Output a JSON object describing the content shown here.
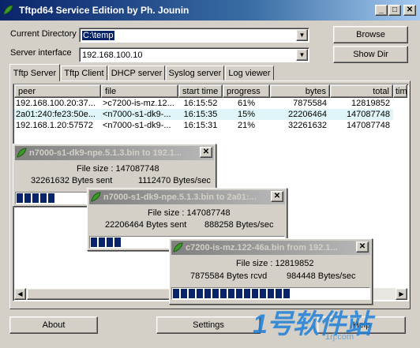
{
  "window": {
    "title": "Tftpd64 Service Edition by Ph. Jounin",
    "min": "_",
    "max": "□",
    "close": "✕"
  },
  "form": {
    "dir_label": "Current Directory",
    "dir_value": "C:\\temp",
    "iface_label": "Server interface",
    "iface_value": "192.168.100.10",
    "browse": "Browse",
    "showdir": "Show Dir"
  },
  "tabs": [
    "Tftp Server",
    "Tftp Client",
    "DHCP server",
    "Syslog server",
    "Log viewer"
  ],
  "table": {
    "headers": [
      "peer",
      "file",
      "start time",
      "progress",
      "bytes",
      "total",
      "tim"
    ],
    "rows": [
      [
        "192.168.100.20:37...",
        ">c7200-is-mz.12...",
        "16:15:52",
        "61%",
        "7875584",
        "12819852"
      ],
      [
        "2a01:240:fe23:50e...",
        "<n7000-s1-dk9-...",
        "16:15:35",
        "15%",
        "22206464",
        "147087748"
      ],
      [
        "192.168.1.20:57572",
        "<n7000-s1-dk9-...",
        "16:15:31",
        "21%",
        "32261632",
        "147087748"
      ]
    ]
  },
  "dialogs": [
    {
      "title": "n7000-s1-dk9-npe.5.1.3.bin to 192.1...",
      "size": "File size : 147087748",
      "count": "32261632 Bytes sent",
      "rate": "1112470 Bytes/sec",
      "progress": 0.21
    },
    {
      "title": "n7000-s1-dk9-npe.5.1.3.bin to 2a01:...",
      "size": "File size : 147087748",
      "count": "22206464 Bytes sent",
      "rate": "888258 Bytes/sec",
      "progress": 0.15
    },
    {
      "title": "c7200-is-mz.122-46a.bin from 192.1...",
      "size": "File size : 12819852",
      "count": "7875584 Bytes rcvd",
      "rate": "984448 Bytes/sec",
      "progress": 0.61
    }
  ],
  "bottom": {
    "about": "About",
    "settings": "Settings",
    "help": "Help"
  },
  "watermark": {
    "brand": "1号软件站",
    "url": "1rj.com"
  },
  "colors": {
    "title_active": "#0a246a",
    "title_inactive": "#808080",
    "progress": "#0a246a",
    "selection": "#dff5f7"
  }
}
